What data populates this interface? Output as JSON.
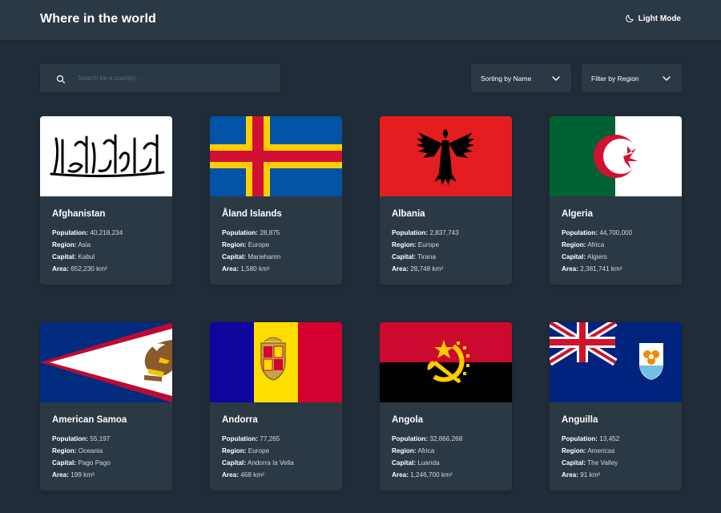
{
  "header": {
    "title": "Where in the world",
    "theme_label": "Light Mode"
  },
  "search": {
    "placeholder": "Search for a country..."
  },
  "controls": {
    "sort_label": "Sorting by Name",
    "filter_label": "Filter by Region"
  },
  "labels": {
    "population": "Population:",
    "region": "Region:",
    "capital": "Capital:",
    "area": "Area:"
  },
  "countries": [
    {
      "name": "Afghanistan",
      "population": "40,218,234",
      "region": "Asia",
      "capital": "Kabul",
      "area": "652,230 km²"
    },
    {
      "name": "Åland Islands",
      "population": "28,875",
      "region": "Europe",
      "capital": "Mariehamn",
      "area": "1,580 km²"
    },
    {
      "name": "Albania",
      "population": "2,837,743",
      "region": "Europe",
      "capital": "Tirana",
      "area": "28,748 km²"
    },
    {
      "name": "Algeria",
      "population": "44,700,000",
      "region": "Africa",
      "capital": "Algiers",
      "area": "2,381,741 km²"
    },
    {
      "name": "American Samoa",
      "population": "55,197",
      "region": "Oceania",
      "capital": "Pago Pago",
      "area": "199 km²"
    },
    {
      "name": "Andorra",
      "population": "77,265",
      "region": "Europe",
      "capital": "Andorra la Vella",
      "area": "468 km²"
    },
    {
      "name": "Angola",
      "population": "32,866,268",
      "region": "Africa",
      "capital": "Luanda",
      "area": "1,246,700 km²"
    },
    {
      "name": "Anguilla",
      "population": "13,452",
      "region": "Americas",
      "capital": "The Valley",
      "area": "91 km²"
    }
  ],
  "colors": {
    "background": "#202c37",
    "element": "#2b3945",
    "text": "#ffffff"
  }
}
